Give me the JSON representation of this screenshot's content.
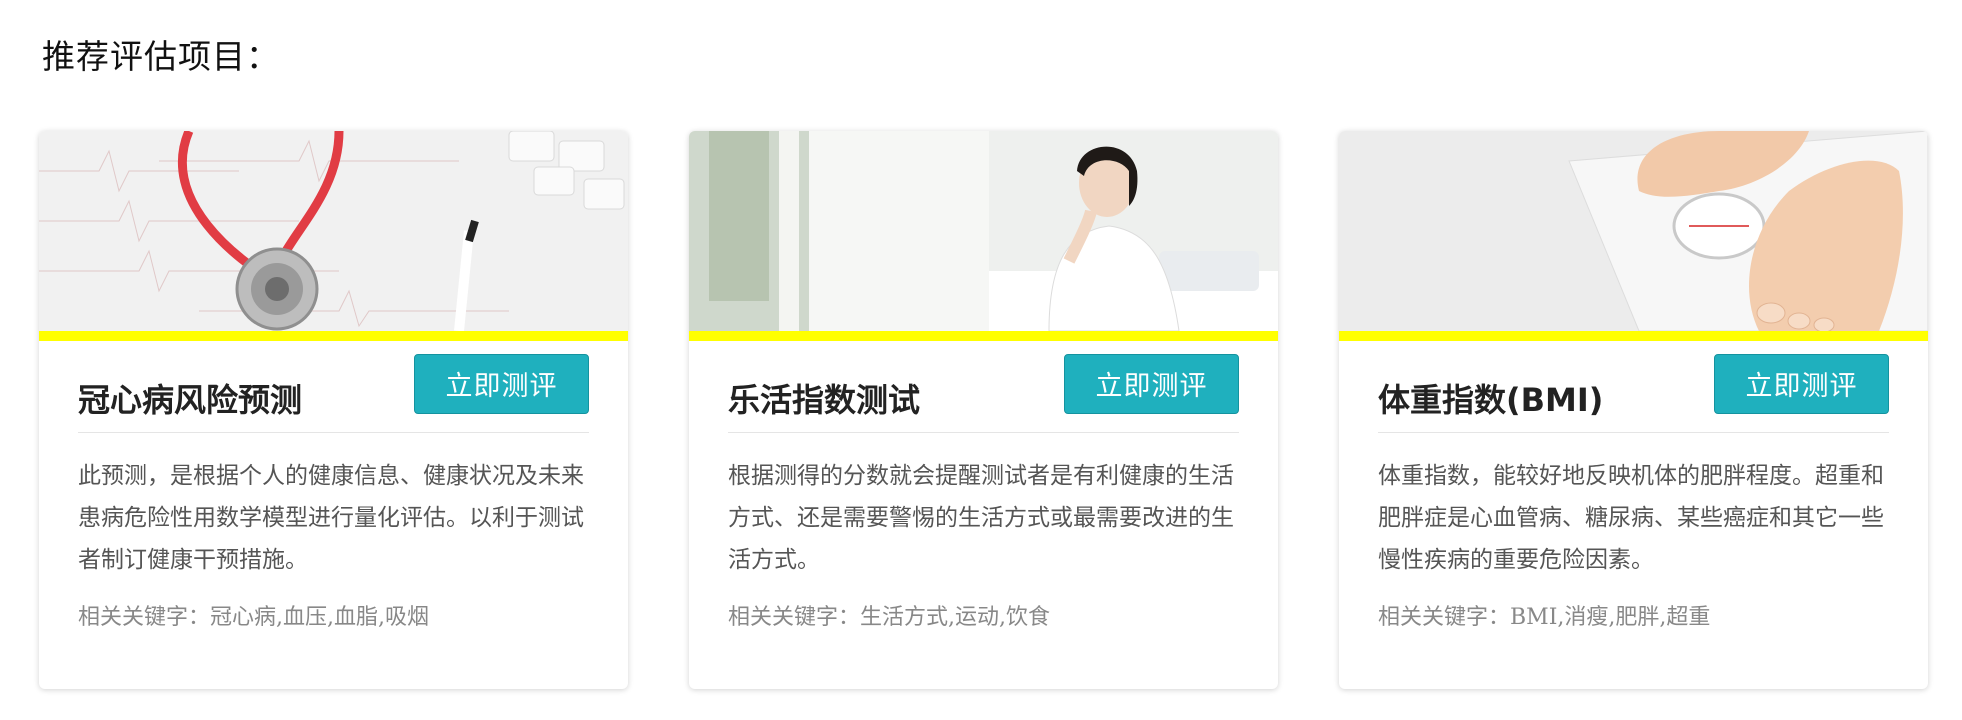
{
  "section_title": "推荐评估项目：",
  "colors": {
    "accent_bar": "#ffff00",
    "button": "#1fb0be"
  },
  "cards": [
    {
      "image": "stethoscope-ecg-image",
      "title": "冠心病风险预测",
      "button_label": "立即测评",
      "description": "此预测，是根据个人的健康信息、健康状况及未来患病危险性用数学模型进行量化评估。以利于测试者制订健康干预措施。",
      "keywords": "相关关键字：冠心病,血压,血脂,吸烟"
    },
    {
      "image": "relaxed-woman-image",
      "title": "乐活指数测试",
      "button_label": "立即测评",
      "description": "根据测得的分数就会提醒测试者是有利健康的生活方式、还是需要警惕的生活方式或最需要改进的生活方式。",
      "keywords": "相关关键字：生活方式,运动,饮食"
    },
    {
      "image": "feet-on-scale-image",
      "title": "体重指数(BMI)",
      "button_label": "立即测评",
      "description": "体重指数，能较好地反映机体的肥胖程度。超重和肥胖症是心血管病、糖尿病、某些癌症和其它一些慢性疾病的重要危险因素。",
      "keywords": "相关关键字：BMI,消瘦,肥胖,超重"
    }
  ]
}
